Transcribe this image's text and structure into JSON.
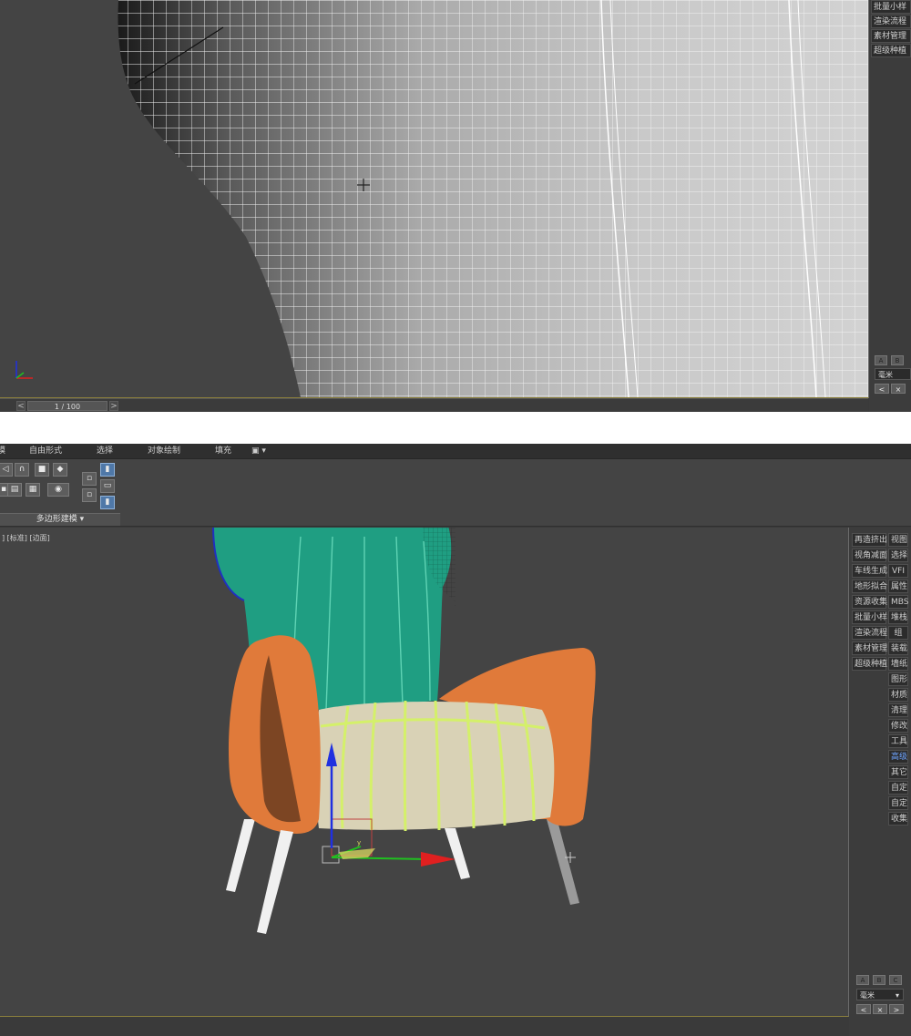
{
  "top": {
    "side_buttons": [
      "批量小样",
      "渲染流程",
      "素材管理",
      "超级种植"
    ],
    "abc": [
      "A",
      "B"
    ],
    "units": "毫米",
    "nav": [
      "<",
      "×"
    ],
    "frame": "1 / 100",
    "tl_prev": "<",
    "tl_next": ">"
  },
  "bottom": {
    "tabs": [
      "建模",
      "自由形式",
      "选择",
      "对象绘制",
      "填充"
    ],
    "group_label": "多边形建模",
    "viewport_label": "] [标准] [边面]",
    "side_left": [
      "再造挤出",
      "视角减面",
      "车线生成",
      "地形拟合",
      "资源收集",
      "批量小样",
      "渲染流程",
      "素材管理",
      "超级种植"
    ],
    "side_right": [
      "视图",
      "选择",
      "VFI",
      "属性",
      "MBS",
      "堆栈",
      "组",
      "装载",
      "墙纸",
      "图形",
      "材质",
      "清理",
      "修改",
      "工具",
      "高级",
      "其它",
      "自定",
      "自定",
      "收集"
    ],
    "highlight_index": 14,
    "abc": [
      "A",
      "B",
      "C"
    ],
    "units": "毫米",
    "nav": [
      "<",
      "×",
      ">"
    ]
  },
  "colors": {
    "backrest": "#1f9e82",
    "arm": "#e07a3a",
    "seat_fill": "#d9d2b6",
    "seat_stripe": "#d4f06a",
    "leg": "#f0f0f0",
    "axis_x": "#e02020",
    "axis_y": "#20c020",
    "axis_z": "#2030e0"
  }
}
